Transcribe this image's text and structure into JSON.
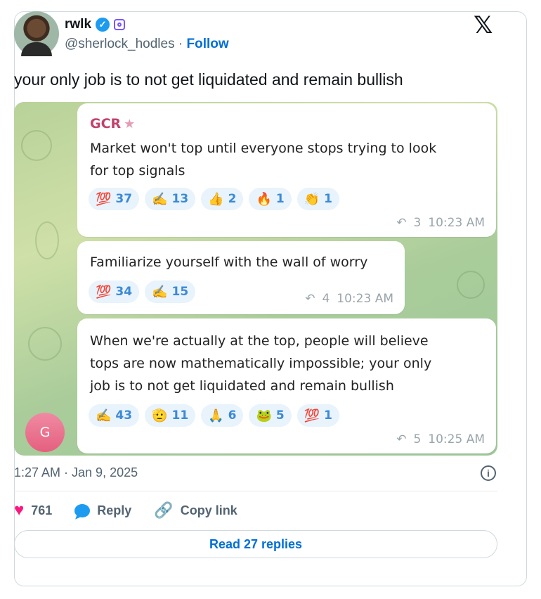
{
  "author": {
    "name": "rwlk",
    "handle": "@sherlock_hodles",
    "separator": "·",
    "follow_label": "Follow"
  },
  "tweet": {
    "text": "your only job is to not get liquidated and remain bullish",
    "timestamp": "1:27 AM · Jan 9, 2025"
  },
  "chat": {
    "sender": "GCR",
    "messages": [
      {
        "text": "Market won't top until everyone stops trying to look\nfor top signals",
        "reactions": [
          {
            "emoji": "💯",
            "count": "37"
          },
          {
            "emoji": "✍️",
            "count": "13"
          },
          {
            "emoji": "👍",
            "count": "2"
          },
          {
            "emoji": "🔥",
            "count": "1"
          },
          {
            "emoji": "👏",
            "count": "1"
          }
        ],
        "forwards": "3",
        "time": "10:23 AM"
      },
      {
        "text": "Familiarize yourself with the wall of worry",
        "reactions": [
          {
            "emoji": "💯",
            "count": "34"
          },
          {
            "emoji": "✍️",
            "count": "15"
          }
        ],
        "forwards": "4",
        "time": "10:23 AM"
      },
      {
        "text": "When we're actually at the top, people will believe\ntops are now mathematically impossible;  your only\njob is to not get liquidated and remain bullish",
        "reactions": [
          {
            "emoji": "✍️",
            "count": "43"
          },
          {
            "emoji": "🫡",
            "count": "11"
          },
          {
            "emoji": "🙏",
            "count": "6"
          },
          {
            "emoji": "🐸",
            "count": "5"
          },
          {
            "emoji": "💯",
            "count": "1"
          }
        ],
        "forwards": "5",
        "time": "10:25 AM"
      }
    ],
    "group_avatar_letter": "G"
  },
  "actions": {
    "likes": "761",
    "reply_label": "Reply",
    "copy_link_label": "Copy link",
    "read_replies_label": "Read 27 replies"
  },
  "colors": {
    "accent": "#006fd6",
    "like": "#f91880",
    "sender": "#c1426c"
  }
}
